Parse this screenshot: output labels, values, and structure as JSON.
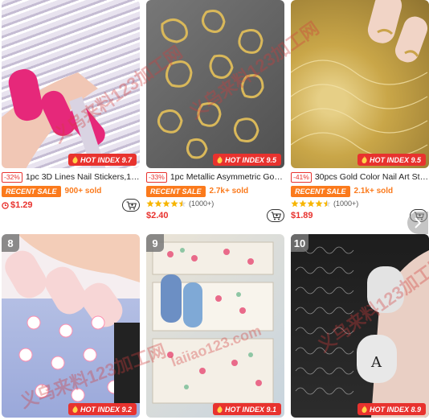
{
  "products": [
    {
      "rank": "",
      "hot_index_label": "HOT INDEX 9.7",
      "discount": "-32%",
      "title": "1pc 3D Lines Nail Stickers,1 Sh...",
      "sale_tag": "RECENT SALE",
      "sold": "900+ sold",
      "rating_count": "",
      "price": "$1.29",
      "has_flash_icon": true,
      "colors": {
        "bg1": "#e9e4ef",
        "bg2": "#cfc6d8",
        "accent": "#e8287a"
      }
    },
    {
      "rank": "",
      "hot_index_label": "HOT INDEX 9.5",
      "discount": "-33%",
      "title": "1pc Metallic Asymmetric Gold F...",
      "sale_tag": "RECENT SALE",
      "sold": "2.7k+ sold",
      "rating_count": "(1000+)",
      "stars": 4.5,
      "price": "$2.40",
      "has_flash_icon": false,
      "colors": {
        "bg1": "#6f6f6f",
        "bg2": "#4d4d4d",
        "accent": "#d6b452"
      }
    },
    {
      "rank": "",
      "hot_index_label": "HOT INDEX 9.5",
      "discount": "-41%",
      "title": "30pcs Gold Color Nail Art Stick...",
      "sale_tag": "RECENT SALE",
      "sold": "2.1k+ sold",
      "rating_count": "(1000+)",
      "stars": 4.5,
      "price": "$1.89",
      "has_flash_icon": false,
      "colors": {
        "bg1": "#d9c27a",
        "bg2": "#b8973f",
        "accent": "#f1dca6"
      }
    },
    {
      "rank": "8",
      "hot_index_label": "HOT INDEX 9.2",
      "colors": {
        "bg1": "#b9c3e6",
        "bg2": "#f2c8d2",
        "accent": "#ff8fb0"
      }
    },
    {
      "rank": "9",
      "hot_index_label": "HOT INDEX 9.1",
      "colors": {
        "bg1": "#e3dccf",
        "bg2": "#9fb7c9",
        "accent": "#e96a8a"
      }
    },
    {
      "rank": "10",
      "hot_index_label": "HOT INDEX 8.9",
      "colors": {
        "bg1": "#1b1b1b",
        "bg2": "#3a3a3a",
        "accent": "#dcdcdc"
      }
    }
  ],
  "watermark_text": "义乌来料123加工网",
  "watermark_text_2": "laiiao123.com",
  "icons": {
    "hot": "flame-icon",
    "cart": "cart-icon",
    "star": "star-icon",
    "flash": "clock-icon",
    "next": "chevron-right-icon"
  },
  "theme": {
    "red": "#e8322e",
    "orange": "#fb7a1c",
    "star": "#f7b500"
  }
}
